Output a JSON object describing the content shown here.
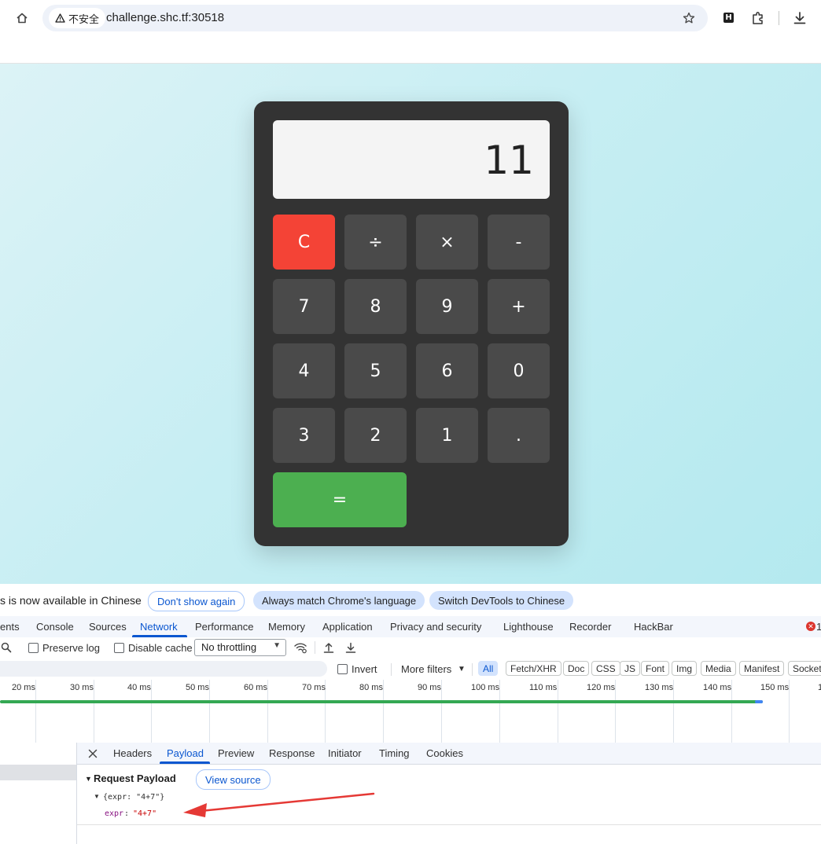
{
  "browser": {
    "security_label": "不安全",
    "url": "challenge.shc.tf:30518"
  },
  "calculator": {
    "display": "11",
    "keys": {
      "clear": "C",
      "divide": "÷",
      "multiply": "×",
      "minus": "-",
      "seven": "7",
      "eight": "8",
      "nine": "9",
      "plus": "+",
      "four": "4",
      "five": "5",
      "six": "6",
      "zero": "0",
      "three": "3",
      "two": "2",
      "one": "1",
      "dot": ".",
      "equals": "="
    }
  },
  "banner": {
    "text": "s is now available in Chinese",
    "dont_show": "Don't show again",
    "always_match": "Always match Chrome's language",
    "switch": "Switch DevTools to Chinese"
  },
  "devtools": {
    "tabs": [
      "ents",
      "Console",
      "Sources",
      "Network",
      "Performance",
      "Memory",
      "Application",
      "Privacy and security",
      "Lighthouse",
      "Recorder",
      "HackBar"
    ],
    "active_tab": "Network",
    "error_count": "1",
    "toolbar": {
      "preserve_log": "Preserve log",
      "disable_cache": "Disable cache",
      "throttling": "No throttling"
    },
    "filters": {
      "invert": "Invert",
      "more_filters": "More filters",
      "types": [
        "All",
        "Fetch/XHR",
        "Doc",
        "CSS",
        "JS",
        "Font",
        "Img",
        "Media",
        "Manifest",
        "Socket"
      ]
    },
    "timeline_ticks": [
      "20 ms",
      "30 ms",
      "40 ms",
      "50 ms",
      "60 ms",
      "70 ms",
      "80 ms",
      "90 ms",
      "100 ms",
      "110 ms",
      "120 ms",
      "130 ms",
      "140 ms",
      "150 ms",
      "1"
    ],
    "detail_tabs": [
      "Headers",
      "Payload",
      "Preview",
      "Response",
      "Initiator",
      "Timing",
      "Cookies"
    ],
    "active_detail_tab": "Payload",
    "payload": {
      "section_title": "Request Payload",
      "view_source": "View source",
      "summary": "{expr: \"4+7\"}",
      "key": "expr",
      "value": "\"4+7\""
    }
  },
  "colors": {
    "clear_key": "#f44336",
    "equals_key": "#4caf50",
    "accent": "#0b57d0",
    "arrow": "#e53935"
  }
}
